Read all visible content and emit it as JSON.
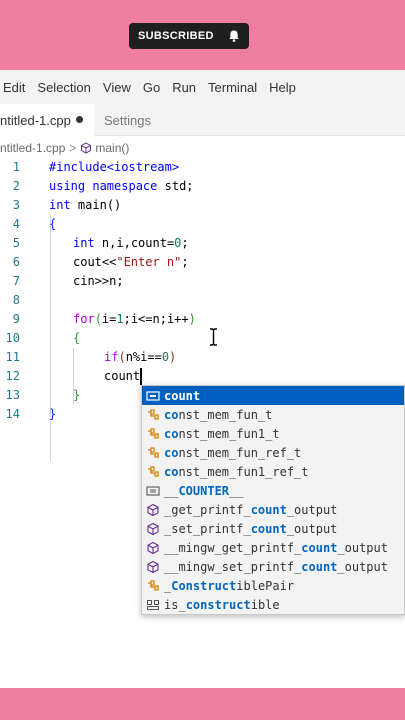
{
  "badge": {
    "label": "SUBSCRIBED",
    "icon": "bell-icon"
  },
  "menu": [
    "Edit",
    "Selection",
    "View",
    "Go",
    "Run",
    "Terminal",
    "Help"
  ],
  "tabs": [
    {
      "label": "ntitled-1.cpp",
      "modified": true
    },
    {
      "label": "Settings"
    }
  ],
  "breadcrumb": {
    "file": "ntitled-1.cpp",
    "sep": ">",
    "symbol": "main()"
  },
  "code": {
    "line_numbers": [
      "1",
      "2",
      "3",
      "4",
      "5",
      "6",
      "7",
      "8",
      "9",
      "10",
      "11",
      "12",
      "13",
      "14"
    ],
    "l1": "#include<iostream>",
    "l2a": "using",
    "l2b": "namespace",
    "l2c": "std;",
    "l3a": "int",
    "l3b": "main()",
    "l4": "{",
    "l5a": "int",
    "l5b": "n,i,count=",
    "l5c": "0",
    "l5d": ";",
    "l6a": "cout<<",
    "l6b": "\"Enter n\"",
    "l6c": ";",
    "l7": "cin>>n;",
    "l9a": "for",
    "l9b": "(",
    "l9c": "i=",
    "l9d": "1",
    "l9e": ";i<=n;i++",
    "l9f": ")",
    "l10": "{",
    "l11a": "if",
    "l11b": "(",
    "l11c": "n%i==",
    "l11d": "0",
    "l11e": ")",
    "l12": "count",
    "l13": "}",
    "l14": "}"
  },
  "suggestions": [
    {
      "parts": [
        "",
        "count",
        ""
      ],
      "icon": "variable-icon",
      "selected": true
    },
    {
      "parts": [
        "",
        "co",
        "nst_mem_fun_t"
      ],
      "icon": "class-template-icon"
    },
    {
      "parts": [
        "",
        "co",
        "nst_mem_fun1_t"
      ],
      "icon": "class-template-icon"
    },
    {
      "parts": [
        "",
        "co",
        "nst_mem_fun_ref_t"
      ],
      "icon": "class-template-icon"
    },
    {
      "parts": [
        "",
        "co",
        "nst_mem_fun1_ref_t"
      ],
      "icon": "class-template-icon"
    },
    {
      "parts": [
        "__",
        "COUNTER",
        "__"
      ],
      "icon": "constant-icon"
    },
    {
      "parts": [
        "_get_printf_",
        "count",
        "_output"
      ],
      "icon": "function-icon"
    },
    {
      "parts": [
        "_set_printf_",
        "count",
        "_output"
      ],
      "icon": "function-icon"
    },
    {
      "parts": [
        "__mingw_get_printf_",
        "count",
        "_output"
      ],
      "icon": "function-icon"
    },
    {
      "parts": [
        "__mingw_set_printf_",
        "count",
        "_output"
      ],
      "icon": "function-icon"
    },
    {
      "parts": [
        "_",
        "Construct",
        "iblePair"
      ],
      "icon": "class-template-icon"
    },
    {
      "parts": [
        "is_",
        "construct",
        "ible"
      ],
      "icon": "struct-icon"
    }
  ],
  "colors": {
    "accent_band": "#ee7fa0",
    "selection": "#0060c0",
    "keyword": "#0000ff",
    "control": "#af00db",
    "string": "#a31515",
    "number": "#098658"
  }
}
